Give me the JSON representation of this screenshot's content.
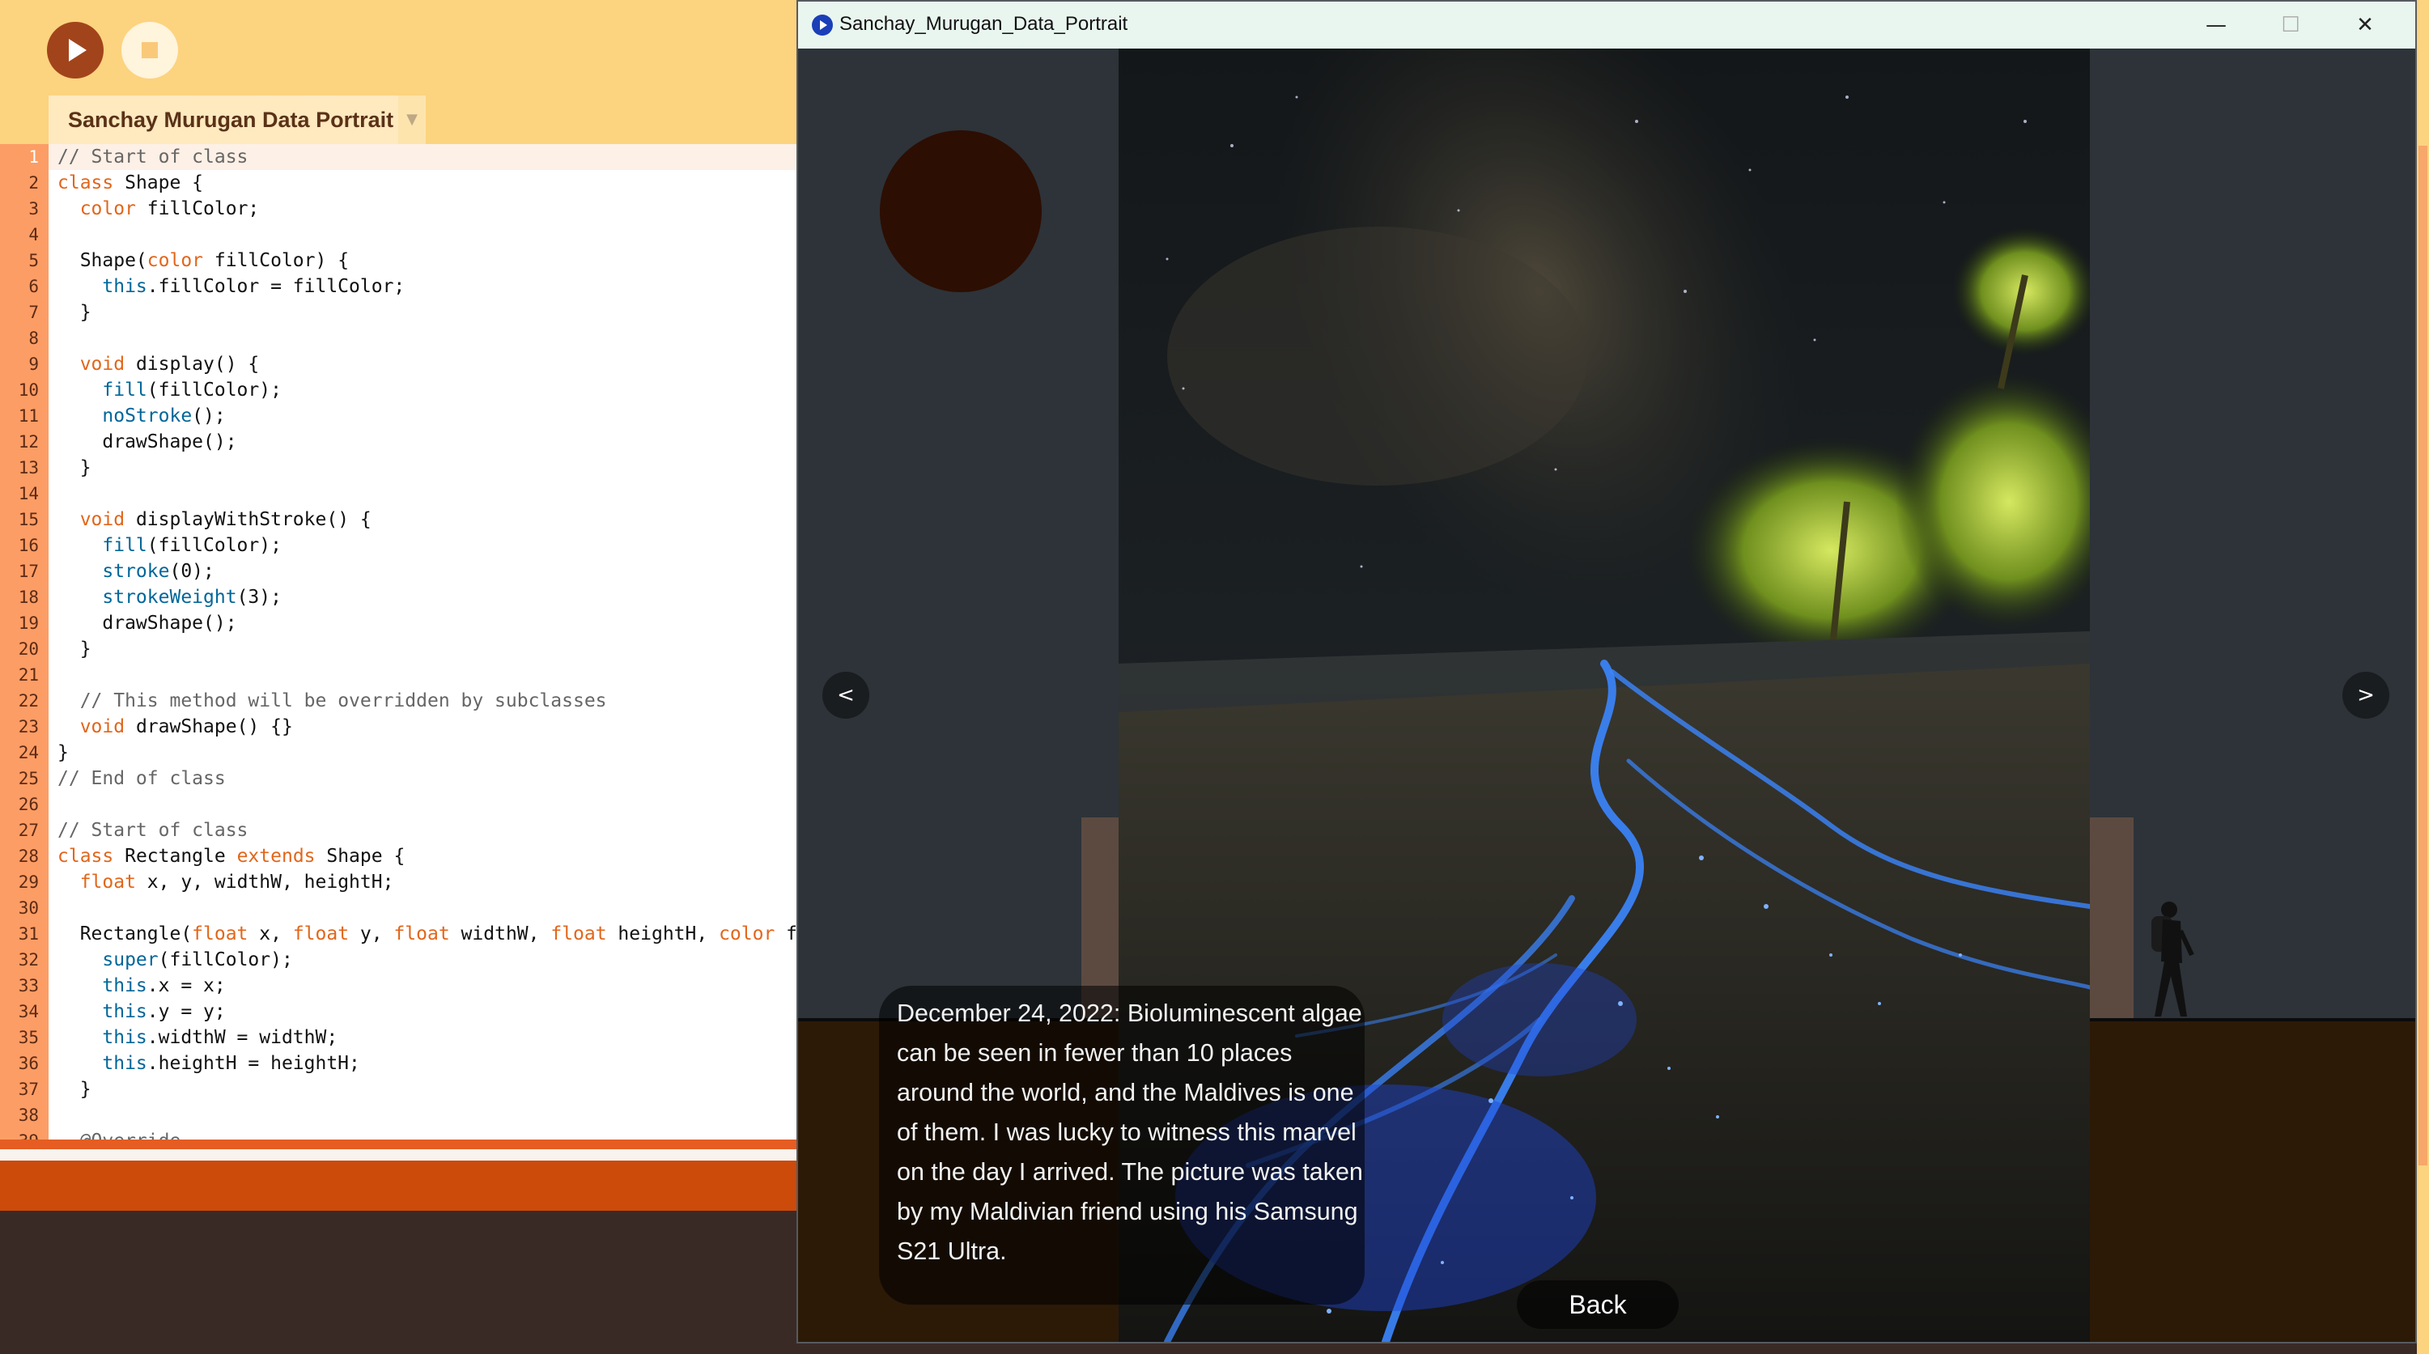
{
  "ide": {
    "run_label": "",
    "tab_label": "Sanchay Murugan Data Portrait",
    "tab_menu": "▼",
    "code_lines": [
      "// Start of class",
      "class Shape {",
      "  color fillColor;",
      "",
      "  Shape(color fillColor) {",
      "    this.fillColor = fillColor;",
      "  }",
      "",
      "  void display() {",
      "    fill(fillColor);",
      "    noStroke();",
      "    drawShape();",
      "  }",
      "",
      "  void displayWithStroke() {",
      "    fill(fillColor);",
      "    stroke(0);",
      "    strokeWeight(3);",
      "    drawShape();",
      "  }",
      "",
      "  // This method will be overridden by subclasses",
      "  void drawShape() {}",
      "}",
      "// End of class",
      "",
      "// Start of class",
      "class Rectangle extends Shape {",
      "  float x, y, widthW, heightH;",
      "",
      "  Rectangle(float x, float y, float widthW, float heightH, color f",
      "    super(fillColor);",
      "    this.x = x;",
      "    this.y = y;",
      "    this.widthW = widthW;",
      "    this.heightH = heightH;",
      "  }",
      "",
      "  @Override"
    ],
    "current_line": 1
  },
  "window": {
    "title": "Sanchay_Murugan_Data_Portrait",
    "minimize": "—",
    "maximize": "☐",
    "close": "✕"
  },
  "sketch": {
    "prev_label": "<",
    "next_label": ">",
    "caption": "December 24, 2022: Bioluminescent algae can be seen in fewer than 10 places around the world, and the Maldives is one of them. I was lucky to witness this marvel on the day I arrived. The picture was taken by my Maldivian friend using his Samsung S21 Ultra.",
    "back_label": "Back"
  },
  "colors": {
    "ide_toolbar": "#fcd37f",
    "run_button": "#a2441b",
    "line_gutter": "#fc9d65",
    "keyword": "#e2661a",
    "function": "#006699",
    "comment": "#666666",
    "glow": "#2f7bff"
  }
}
